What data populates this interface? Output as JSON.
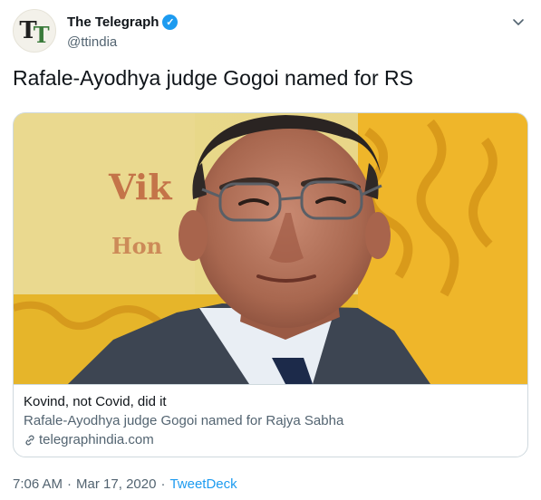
{
  "author": {
    "avatar_text_1": "T",
    "avatar_text_2": "T",
    "display_name": "The Telegraph",
    "handle": "@ttindia",
    "verified_icon": "verified-badge-icon"
  },
  "tweet": {
    "text": "Rafale-Ayodhya judge Gogoi named for RS"
  },
  "card": {
    "image_subject": "photo of an older man in suit and glasses, yellow patterned background with partial text",
    "image_text": "Vik",
    "image_text_2": "Hon",
    "title": "Kovind, not Covid, did it",
    "description": "Rafale-Ayodhya judge Gogoi named for Rajya Sabha",
    "domain": "telegraphindia.com",
    "link_icon": "link-icon"
  },
  "meta": {
    "time": "7:06 AM",
    "separator": "·",
    "date": "Mar 17, 2020",
    "source": "TweetDeck"
  },
  "colors": {
    "accent": "#1d9bf0",
    "secondary_text": "#536471",
    "border": "#cfd9de"
  }
}
